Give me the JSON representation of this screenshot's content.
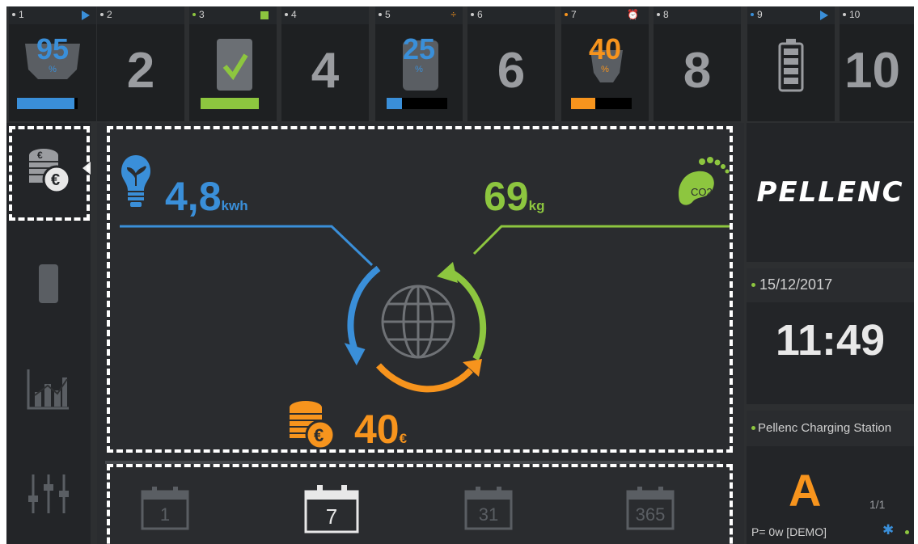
{
  "slots": [
    {
      "num": "1",
      "value": "95",
      "pct": "%",
      "battery_level": 0.95,
      "indicator": "play",
      "color": "#3a8fd9"
    },
    {
      "num": "2",
      "big": "2"
    },
    {
      "num": "3",
      "indicator": "stop",
      "color": "#8dc63f",
      "battery_level": 1.0,
      "status": "check"
    },
    {
      "num": "4",
      "big": "4"
    },
    {
      "num": "5",
      "value": "25",
      "pct": "%",
      "battery_level": 0.25,
      "indicator": "÷",
      "color": "#3a8fd9"
    },
    {
      "num": "6",
      "big": "6"
    },
    {
      "num": "7",
      "value": "40",
      "pct": "%",
      "battery_level": 0.4,
      "indicator": "alarm",
      "color": "#f7941d"
    },
    {
      "num": "8",
      "big": "8"
    },
    {
      "num": "9",
      "indicator": "play",
      "color": "#3a8fd9"
    },
    {
      "num": "10",
      "big": "10"
    }
  ],
  "energy": {
    "value": "4,8",
    "unit": "kwh",
    "color": "#3a8fd9"
  },
  "co2": {
    "value": "69",
    "unit": "kg",
    "label": "CO2",
    "color": "#8dc63f"
  },
  "money": {
    "value": "40",
    "unit": "€",
    "color": "#f7941d"
  },
  "periods": [
    "1",
    "7",
    "31",
    "365"
  ],
  "selected_period": "7",
  "brand": "PELLENC",
  "date": "15/12/2017",
  "time": "11:49",
  "station": {
    "name": "Pellenc Charging Station",
    "letter": "A",
    "page": "1/1",
    "power": "P= 0w [DEMO]"
  },
  "nav_icons": [
    "coins-icon",
    "battery-pellenc-icon",
    "chart-icon",
    "sliders-icon"
  ]
}
